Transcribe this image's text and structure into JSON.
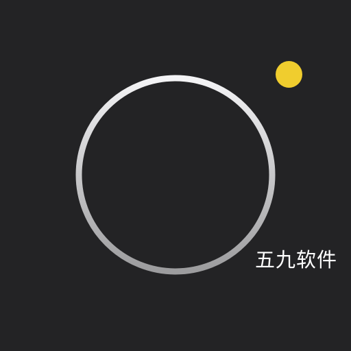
{
  "icon": {
    "name": "camera-app-icon",
    "background_color": "#232325",
    "ring_color_top": "#f4f4f6",
    "ring_color_bottom": "#9c9c9e",
    "indicator_color": "#f0cd2e"
  },
  "watermark": {
    "text": "五九软件",
    "color": "#ffffff"
  }
}
